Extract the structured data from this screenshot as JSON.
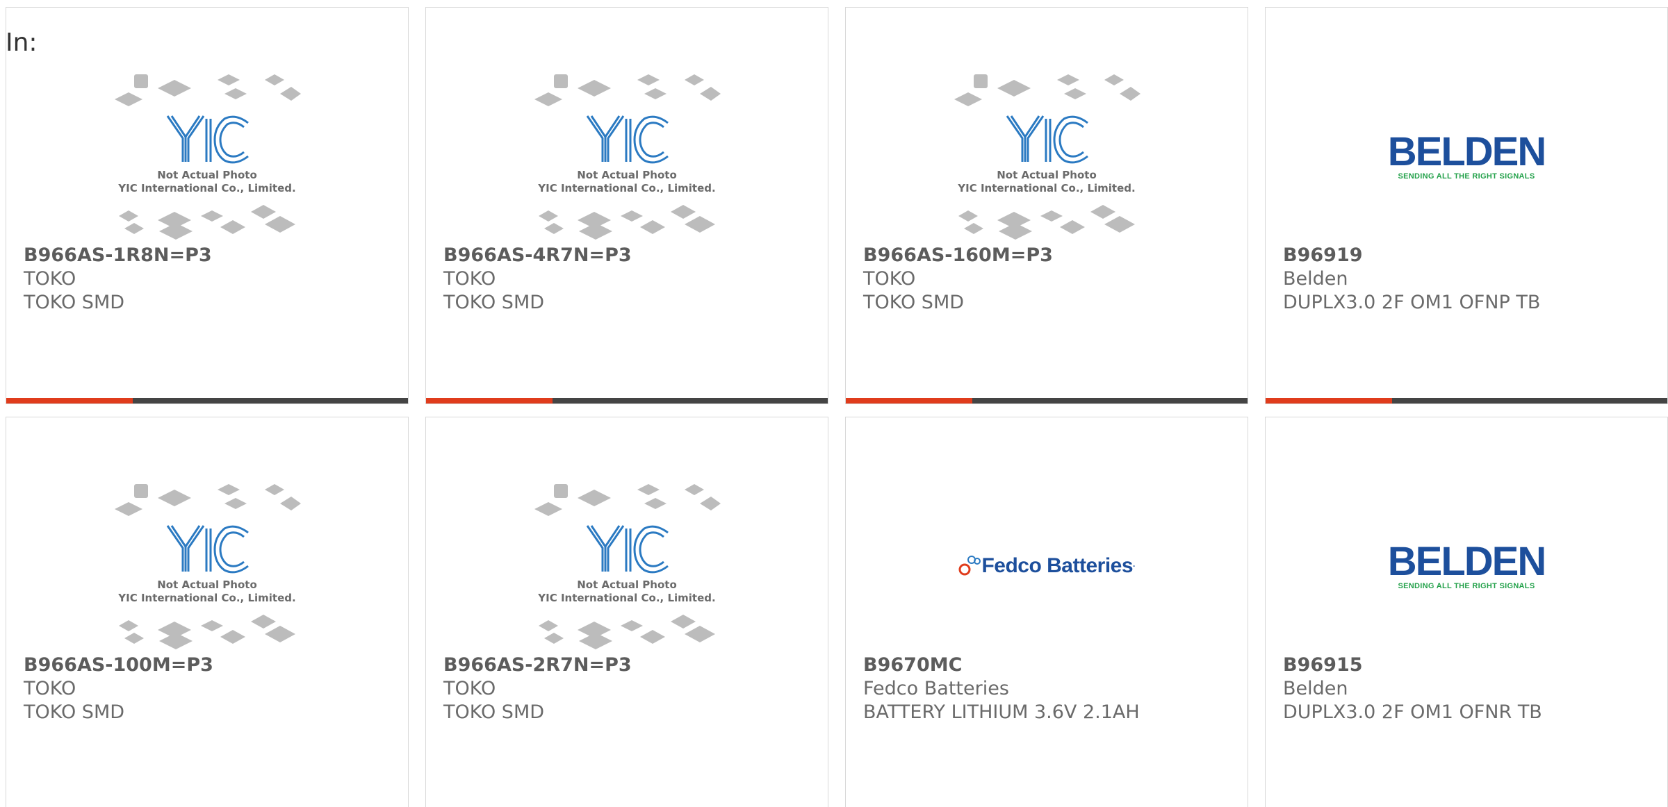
{
  "header": {
    "in_label": "In:"
  },
  "placeholder": {
    "line1": "Not Actual Photo",
    "line2": "YIC International Co., Limited.",
    "logo_text": "YIC"
  },
  "brand_logos": {
    "belden_word": "BELDEN",
    "belden_tagline": "SENDING ALL THE RIGHT SIGNALS",
    "fedco_word": "Fedco Batteries"
  },
  "colors": {
    "accent": "#e03c1c",
    "bar_dark": "#444444",
    "text_gray": "#6a6a6a",
    "belden_blue": "#1d4f9c",
    "belden_green": "#23a14a"
  },
  "products": [
    {
      "part": "B966AS-1R8N=P3",
      "manufacturer": "TOKO",
      "description": "TOKO SMD",
      "image": "placeholder"
    },
    {
      "part": "B966AS-4R7N=P3",
      "manufacturer": "TOKO",
      "description": "TOKO SMD",
      "image": "placeholder"
    },
    {
      "part": "B966AS-160M=P3",
      "manufacturer": "TOKO",
      "description": "TOKO SMD",
      "image": "placeholder"
    },
    {
      "part": "B96919",
      "manufacturer": "Belden",
      "description": "DUPLX3.0 2F OM1 OFNP TB",
      "image": "belden-logo"
    },
    {
      "part": "B966AS-100M=P3",
      "manufacturer": "TOKO",
      "description": "TOKO SMD",
      "image": "placeholder"
    },
    {
      "part": "B966AS-2R7N=P3",
      "manufacturer": "TOKO",
      "description": "TOKO SMD",
      "image": "placeholder"
    },
    {
      "part": "B9670MC",
      "manufacturer": "Fedco Batteries",
      "description": "BATTERY LITHIUM 3.6V 2.1AH",
      "image": "fedco-logo"
    },
    {
      "part": "B96915",
      "manufacturer": "Belden",
      "description": "DUPLX3.0 2F OM1 OFNR TB",
      "image": "belden-logo"
    }
  ]
}
